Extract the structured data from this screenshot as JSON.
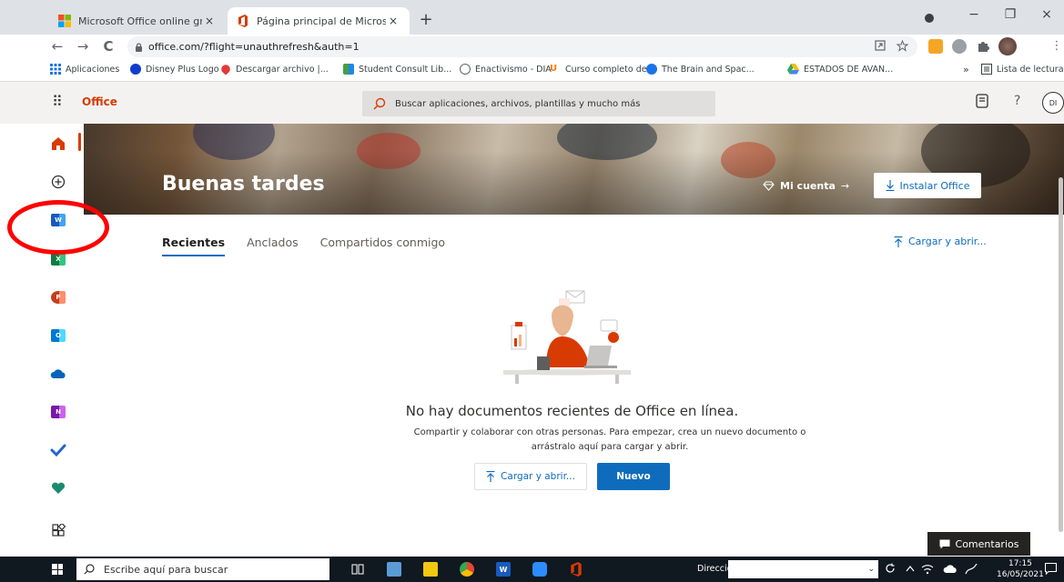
{
  "browser": {
    "tabs": [
      {
        "title": "Microsoft Office online gratuito, ",
        "active": false
      },
      {
        "title": "Página principal de Microsoft Offi",
        "active": true
      }
    ],
    "new_tab": "+",
    "close_glyph": "×",
    "url": "office.com/?flight=unauthrefresh&auth=1",
    "nav": {
      "back": "←",
      "forward": "→",
      "reload": "C"
    },
    "window_controls": {
      "minimize": "−",
      "maximize": "❐",
      "close": "×"
    },
    "bookmarks": [
      {
        "label": "Aplicaciones",
        "color": "#1a73e8"
      },
      {
        "label": "Disney Plus Logo",
        "color": "#113ccf"
      },
      {
        "label": "Descargar archivo |...",
        "color": "#e53935"
      },
      {
        "label": "Student Consult Lib...",
        "color": "#1e88e5"
      },
      {
        "label": "Enactivismo - DIA",
        "color": "#5f6368"
      },
      {
        "label": "Curso completo de...",
        "color": "#f57c00"
      },
      {
        "label": "The Brain and Spac...",
        "color": "#1a73e8"
      },
      {
        "label": "ESTADOS DE AVAN...",
        "color": "#34a853"
      }
    ],
    "bookmarks_overflow": "»",
    "reading_list": "Lista de lectura"
  },
  "office": {
    "brand": "Office",
    "search_placeholder": "Buscar aplicaciones, archivos, plantillas y mucho más",
    "help": "?",
    "avatar_initials": "DI",
    "accent": "#d83b01",
    "primary": "#0f6cbd",
    "rail": [
      {
        "name": "home",
        "letter": "",
        "color": "#d83b01"
      },
      {
        "name": "create",
        "letter": "",
        "color": "#323130"
      },
      {
        "name": "word",
        "letter": "W",
        "color": "#185abd"
      },
      {
        "name": "excel",
        "letter": "X",
        "color": "#107c41"
      },
      {
        "name": "powerpoint",
        "letter": "P",
        "color": "#c43e1c"
      },
      {
        "name": "outlook",
        "letter": "O",
        "color": "#0078d4"
      },
      {
        "name": "onedrive",
        "letter": "",
        "color": "#0364b8"
      },
      {
        "name": "onenote",
        "letter": "N",
        "color": "#7719aa"
      },
      {
        "name": "todo",
        "letter": "",
        "color": "#2564cf"
      },
      {
        "name": "family-safety",
        "letter": "",
        "color": "#1d8a6f"
      },
      {
        "name": "all-apps",
        "letter": "",
        "color": "#323130"
      }
    ],
    "hero": {
      "greeting": "Buenas tardes",
      "account": "Mi cuenta",
      "account_arrow": "→",
      "install": "Instalar Office"
    },
    "tabs": [
      {
        "label": "Recientes",
        "active": true
      },
      {
        "label": "Anclados",
        "active": false
      },
      {
        "label": "Compartidos conmigo",
        "active": false
      }
    ],
    "upload_link": "Cargar y abrir...",
    "empty": {
      "title": "No hay documentos recientes de Office en línea.",
      "desc_line1": "Compartir y colaborar con otras personas. Para empezar, crea un nuevo documento o",
      "desc_line2": "arrástralo aquí para cargar y abrir.",
      "upload_btn": "Cargar y abrir...",
      "new_btn": "Nuevo"
    },
    "comments": "Comentarios"
  },
  "taskbar": {
    "search_placeholder": "Escribe aquí para buscar",
    "address_label": "Dirección",
    "address_dropdown": "⌄",
    "time": "17:15",
    "date": "16/05/2021"
  }
}
